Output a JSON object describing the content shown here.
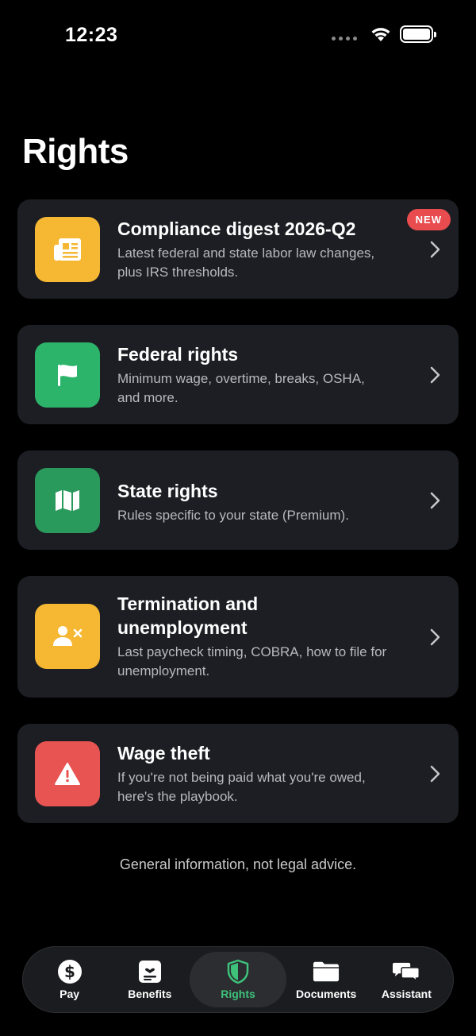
{
  "status_bar": {
    "time": "12:23"
  },
  "page": {
    "title": "Rights"
  },
  "cards": [
    {
      "title": "Compliance digest 2026-Q2",
      "description": "Latest federal and state labor law changes, plus IRS thresholds.",
      "badge": "NEW",
      "icon": "newspaper-icon",
      "color": "#f6b733"
    },
    {
      "title": "Federal rights",
      "description": "Minimum wage, overtime, breaks, OSHA, and more.",
      "icon": "flag-icon",
      "color": "#2db46b"
    },
    {
      "title": "State rights",
      "description": "Rules specific to your state (Premium).",
      "icon": "map-icon",
      "color": "#2a9a5c"
    },
    {
      "title": "Termination and unemployment",
      "description": "Last paycheck timing, COBRA, how to file for unemployment.",
      "icon": "person-remove-icon",
      "color": "#f6b733"
    },
    {
      "title": "Wage theft",
      "description": "If you're not being paid what you're owed, here's the playbook.",
      "icon": "warning-icon",
      "color": "#e85452"
    }
  ],
  "disclaimer": "General information, not legal advice.",
  "tabs": [
    {
      "label": "Pay",
      "icon": "dollar-icon",
      "active": false
    },
    {
      "label": "Benefits",
      "icon": "benefits-icon",
      "active": false
    },
    {
      "label": "Rights",
      "icon": "shield-icon",
      "active": true
    },
    {
      "label": "Documents",
      "icon": "folder-icon",
      "active": false
    },
    {
      "label": "Assistant",
      "icon": "chat-bubbles-icon",
      "active": false
    }
  ],
  "colors": {
    "accent": "#3ec27a",
    "card_bg": "#1c1e23",
    "badge": "#e84c4f"
  }
}
